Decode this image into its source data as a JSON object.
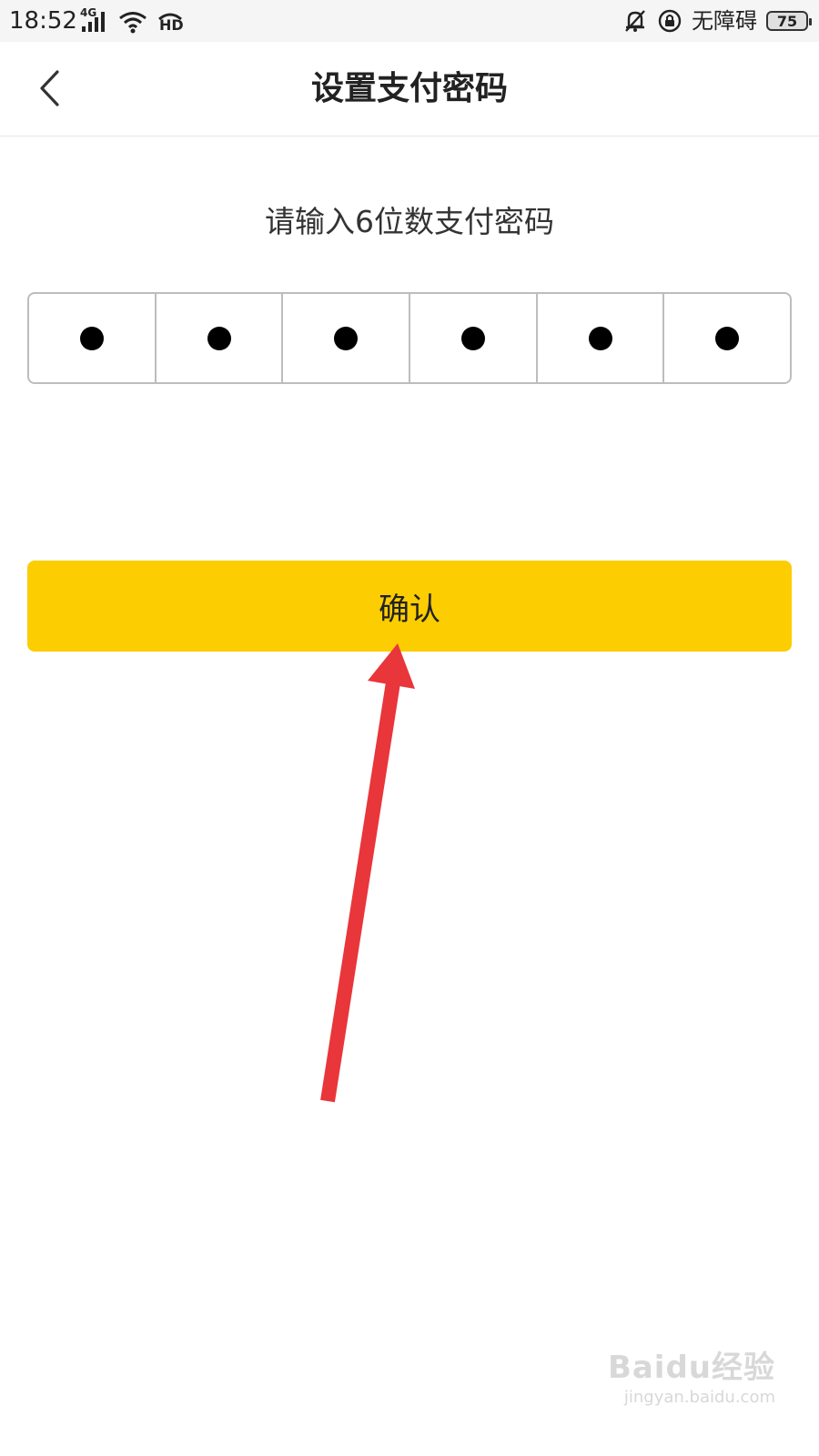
{
  "status_bar": {
    "time": "18:52",
    "network_label": "4G",
    "hd_label": "HD",
    "accessibility_label": "无障碍",
    "battery_level": "75",
    "icons": [
      "signal-icon",
      "wifi-icon",
      "hd-call-icon",
      "mute-bell-icon",
      "rotation-lock-icon",
      "battery-icon"
    ]
  },
  "nav": {
    "title": "设置支付密码",
    "back_icon": "chevron-left-icon"
  },
  "main": {
    "prompt": "请输入6位数支付密码",
    "pin_length": 6,
    "pin_filled": 6,
    "confirm_label": "确认"
  },
  "annotation": {
    "arrow_color": "#e8363a",
    "arrow_target": "confirm-button"
  },
  "watermark": {
    "logo": "Baidu经验",
    "url": "jingyan.baidu.com"
  },
  "colors": {
    "accent": "#fccd01",
    "status_bar_bg": "#f5f5f5",
    "text": "#222222",
    "border": "#bdbdbd"
  }
}
